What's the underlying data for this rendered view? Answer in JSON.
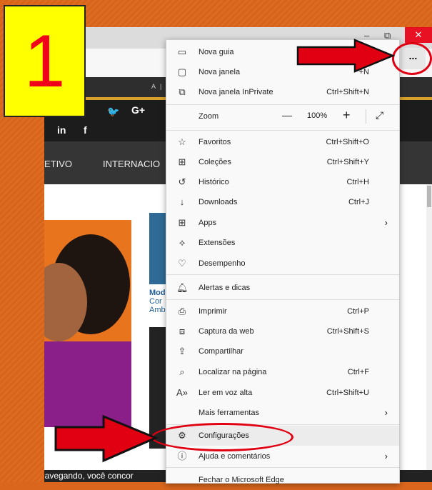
{
  "step_number": "1",
  "window": {
    "minimize": "–",
    "maximize": "⧉",
    "close": "✕"
  },
  "more_button": "...",
  "site": {
    "top_strip": "A |",
    "social": [
      "in",
      "f",
      "G+"
    ],
    "nav": [
      "ETIVO",
      "INTERNACIO"
    ],
    "article_text": [
      "Mod",
      "Cor",
      "Amb"
    ],
    "footer_text": "navegando, você concor"
  },
  "menu": {
    "items": [
      {
        "label": "Nova guia",
        "shortcut": "",
        "icon": "tab-icon"
      },
      {
        "label": "Nova janela",
        "shortcut": "+N",
        "icon": "window-icon"
      },
      {
        "label": "Nova janela InPrivate",
        "shortcut": "Ctrl+Shift+N",
        "icon": "inprivate-icon"
      },
      {
        "label": "Favoritos",
        "shortcut": "Ctrl+Shift+O",
        "icon": "favorites-icon"
      },
      {
        "label": "Coleções",
        "shortcut": "Ctrl+Shift+Y",
        "icon": "collections-icon"
      },
      {
        "label": "Histórico",
        "shortcut": "Ctrl+H",
        "icon": "history-icon"
      },
      {
        "label": "Downloads",
        "shortcut": "Ctrl+J",
        "icon": "download-icon"
      },
      {
        "label": "Apps",
        "shortcut": "",
        "icon": "apps-icon"
      },
      {
        "label": "Extensões",
        "shortcut": "",
        "icon": "extensions-icon"
      },
      {
        "label": "Desempenho",
        "shortcut": "",
        "icon": "performance-icon"
      },
      {
        "label": "Alertas e dicas",
        "shortcut": "",
        "icon": "bell-icon"
      },
      {
        "label": "Imprimir",
        "shortcut": "Ctrl+P",
        "icon": "print-icon"
      },
      {
        "label": "Captura da web",
        "shortcut": "Ctrl+Shift+S",
        "icon": "capture-icon"
      },
      {
        "label": "Compartilhar",
        "shortcut": "",
        "icon": "share-icon"
      },
      {
        "label": "Localizar na página",
        "shortcut": "Ctrl+F",
        "icon": "find-icon"
      },
      {
        "label": "Ler em voz alta",
        "shortcut": "Ctrl+Shift+U",
        "icon": "read-aloud-icon"
      },
      {
        "label": "Mais ferramentas",
        "shortcut": "",
        "icon": ""
      },
      {
        "label": "Configurações",
        "shortcut": "",
        "icon": "gear-icon"
      },
      {
        "label": "Ajuda e comentários",
        "shortcut": "",
        "icon": "help-icon"
      },
      {
        "label": "Fechar o Microsoft Edge",
        "shortcut": "",
        "icon": ""
      }
    ],
    "zoom": {
      "label": "Zoom",
      "minus": "—",
      "value": "100%",
      "plus": "+",
      "fullscreen": "⤢"
    },
    "arrow": "›"
  },
  "colors": {
    "annotation_red": "#e00012",
    "step_yellow": "#ffff00",
    "background_orange": "#d9661c"
  }
}
